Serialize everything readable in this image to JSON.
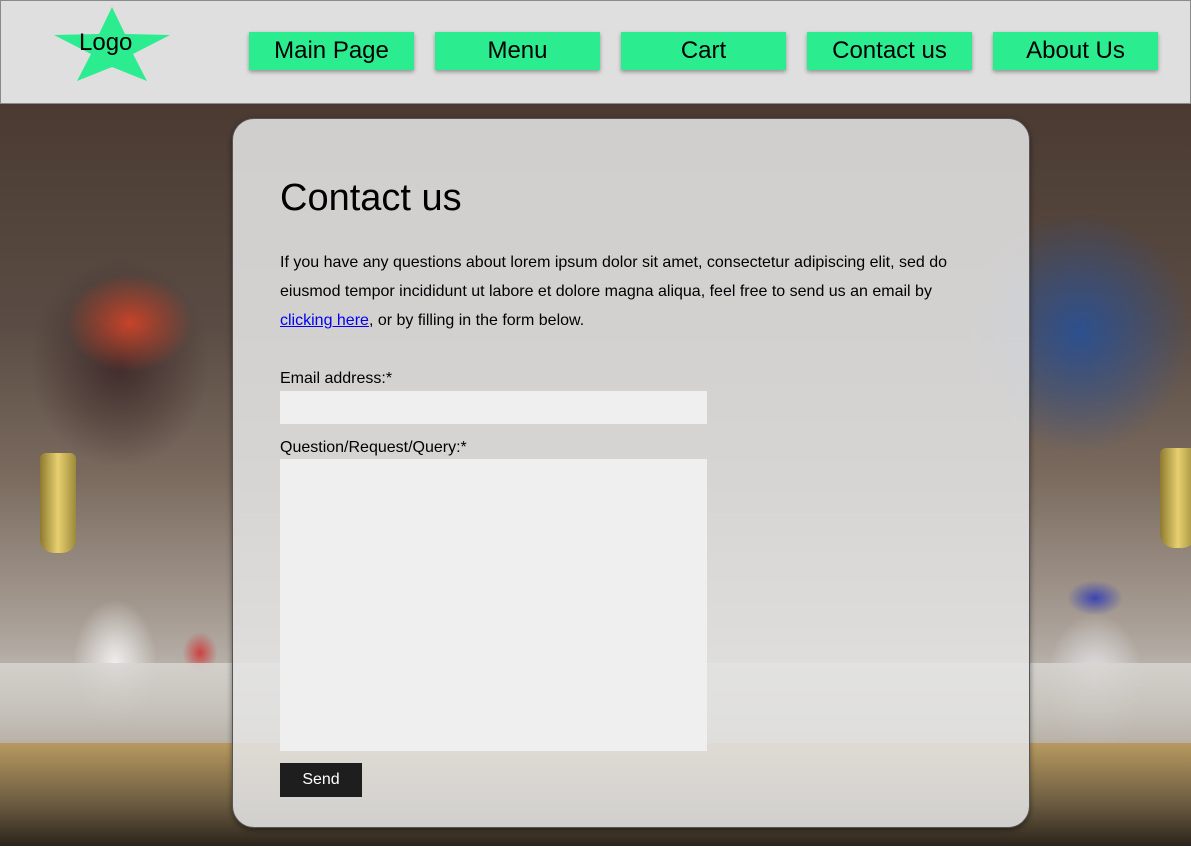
{
  "header": {
    "logo_label": "Logo",
    "nav": [
      {
        "label": "Main Page"
      },
      {
        "label": "Menu"
      },
      {
        "label": "Cart"
      },
      {
        "label": "Contact us"
      },
      {
        "label": "About Us"
      }
    ]
  },
  "main": {
    "title": "Contact us",
    "intro_before_link": "If you have any questions about lorem ipsum dolor sit amet, consectetur adipiscing elit, sed do eiusmod tempor incididunt ut labore et dolore magna aliqua, feel free to send us an email by ",
    "intro_link": "clicking here",
    "intro_after_link": ", or by filling in the form below.",
    "form": {
      "email_label": "Email address:*",
      "email_value": "",
      "query_label": "Question/Request/Query:*",
      "query_value": "",
      "send_label": "Send"
    }
  },
  "colors": {
    "nav_button": "#2bec8f",
    "logo_star": "#2bec8f",
    "header_bg": "#dfdfdf",
    "send_button": "#1e1e1e",
    "link": "#0000ee"
  },
  "icons": {
    "logo": "star-icon"
  }
}
